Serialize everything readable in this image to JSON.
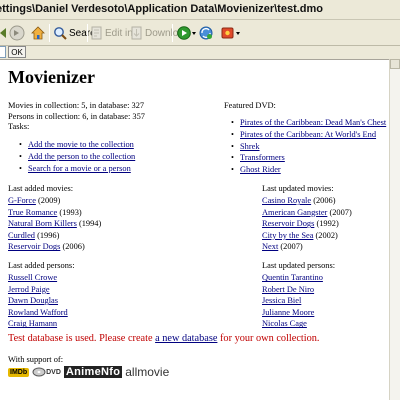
{
  "window": {
    "title": "ettings\\Daniel Verdesoto\\Application Data\\Movienizer\\test.dmo"
  },
  "toolbar": {
    "search_label": "Search",
    "edit_info_label": "Edit info",
    "download_label": "Download"
  },
  "addressbar": {
    "ok_label": "OK"
  },
  "page": {
    "title": "Movienizer",
    "stats": {
      "movies": "Movies in collection: 5, in database: 327",
      "persons": "Persons in collection: 6, in database: 357"
    },
    "tasks": {
      "heading": "Tasks:",
      "items": [
        "Add the movie to the collection",
        "Add the person to the collection",
        "Search for a movie or a person"
      ]
    },
    "featured": {
      "heading": "Featured DVD:",
      "items": [
        "Pirates of the Caribbean: Dead Man's Chest",
        "Pirates of the Caribbean: At World's End",
        "Shrek",
        "Transformers",
        "Ghost Rider"
      ]
    },
    "last_added_movies": {
      "heading": "Last added movies:",
      "items": [
        {
          "title": "G-Force",
          "year": " (2009)"
        },
        {
          "title": "True Romance",
          "year": " (1993)"
        },
        {
          "title": "Natural Born Killers",
          "year": " (1994)"
        },
        {
          "title": "Curdled",
          "year": " (1996)"
        },
        {
          "title": "Reservoir Dogs",
          "year": " (2006)"
        }
      ]
    },
    "last_updated_movies": {
      "heading": "Last updated movies:",
      "items": [
        {
          "title": "Casino Royale",
          "year": " (2006)"
        },
        {
          "title": "American Gangster",
          "year": " (2007)"
        },
        {
          "title": "Reservoir Dogs",
          "year": " (1992)"
        },
        {
          "title": "City by the Sea",
          "year": " (2002)"
        },
        {
          "title": "Next",
          "year": " (2007)"
        }
      ]
    },
    "last_added_persons": {
      "heading": "Last added persons:",
      "items": [
        "Russell Crowe",
        "Jerrod Paige",
        "Dawn Douglas",
        "Rowland Wafford",
        "Craig Hamann"
      ]
    },
    "last_updated_persons": {
      "heading": "Last updated persons:",
      "items": [
        "Quentin Tarantino",
        "Robert De Niro",
        "Jessica Biel",
        "Julianne Moore",
        "Nicolas Cage"
      ]
    },
    "warning": {
      "before": "Test database is used. Please create ",
      "link": "a new database",
      "after": " for your own collection."
    },
    "support": {
      "heading": "With support of:",
      "imdb": "IMDb",
      "dvd": "DVD",
      "animenfo": "AnimeNfo",
      "allmovie": "allmovie"
    }
  },
  "colors": {
    "link": "#000080",
    "warning": "#c00000",
    "chrome": "#ece9d8"
  }
}
